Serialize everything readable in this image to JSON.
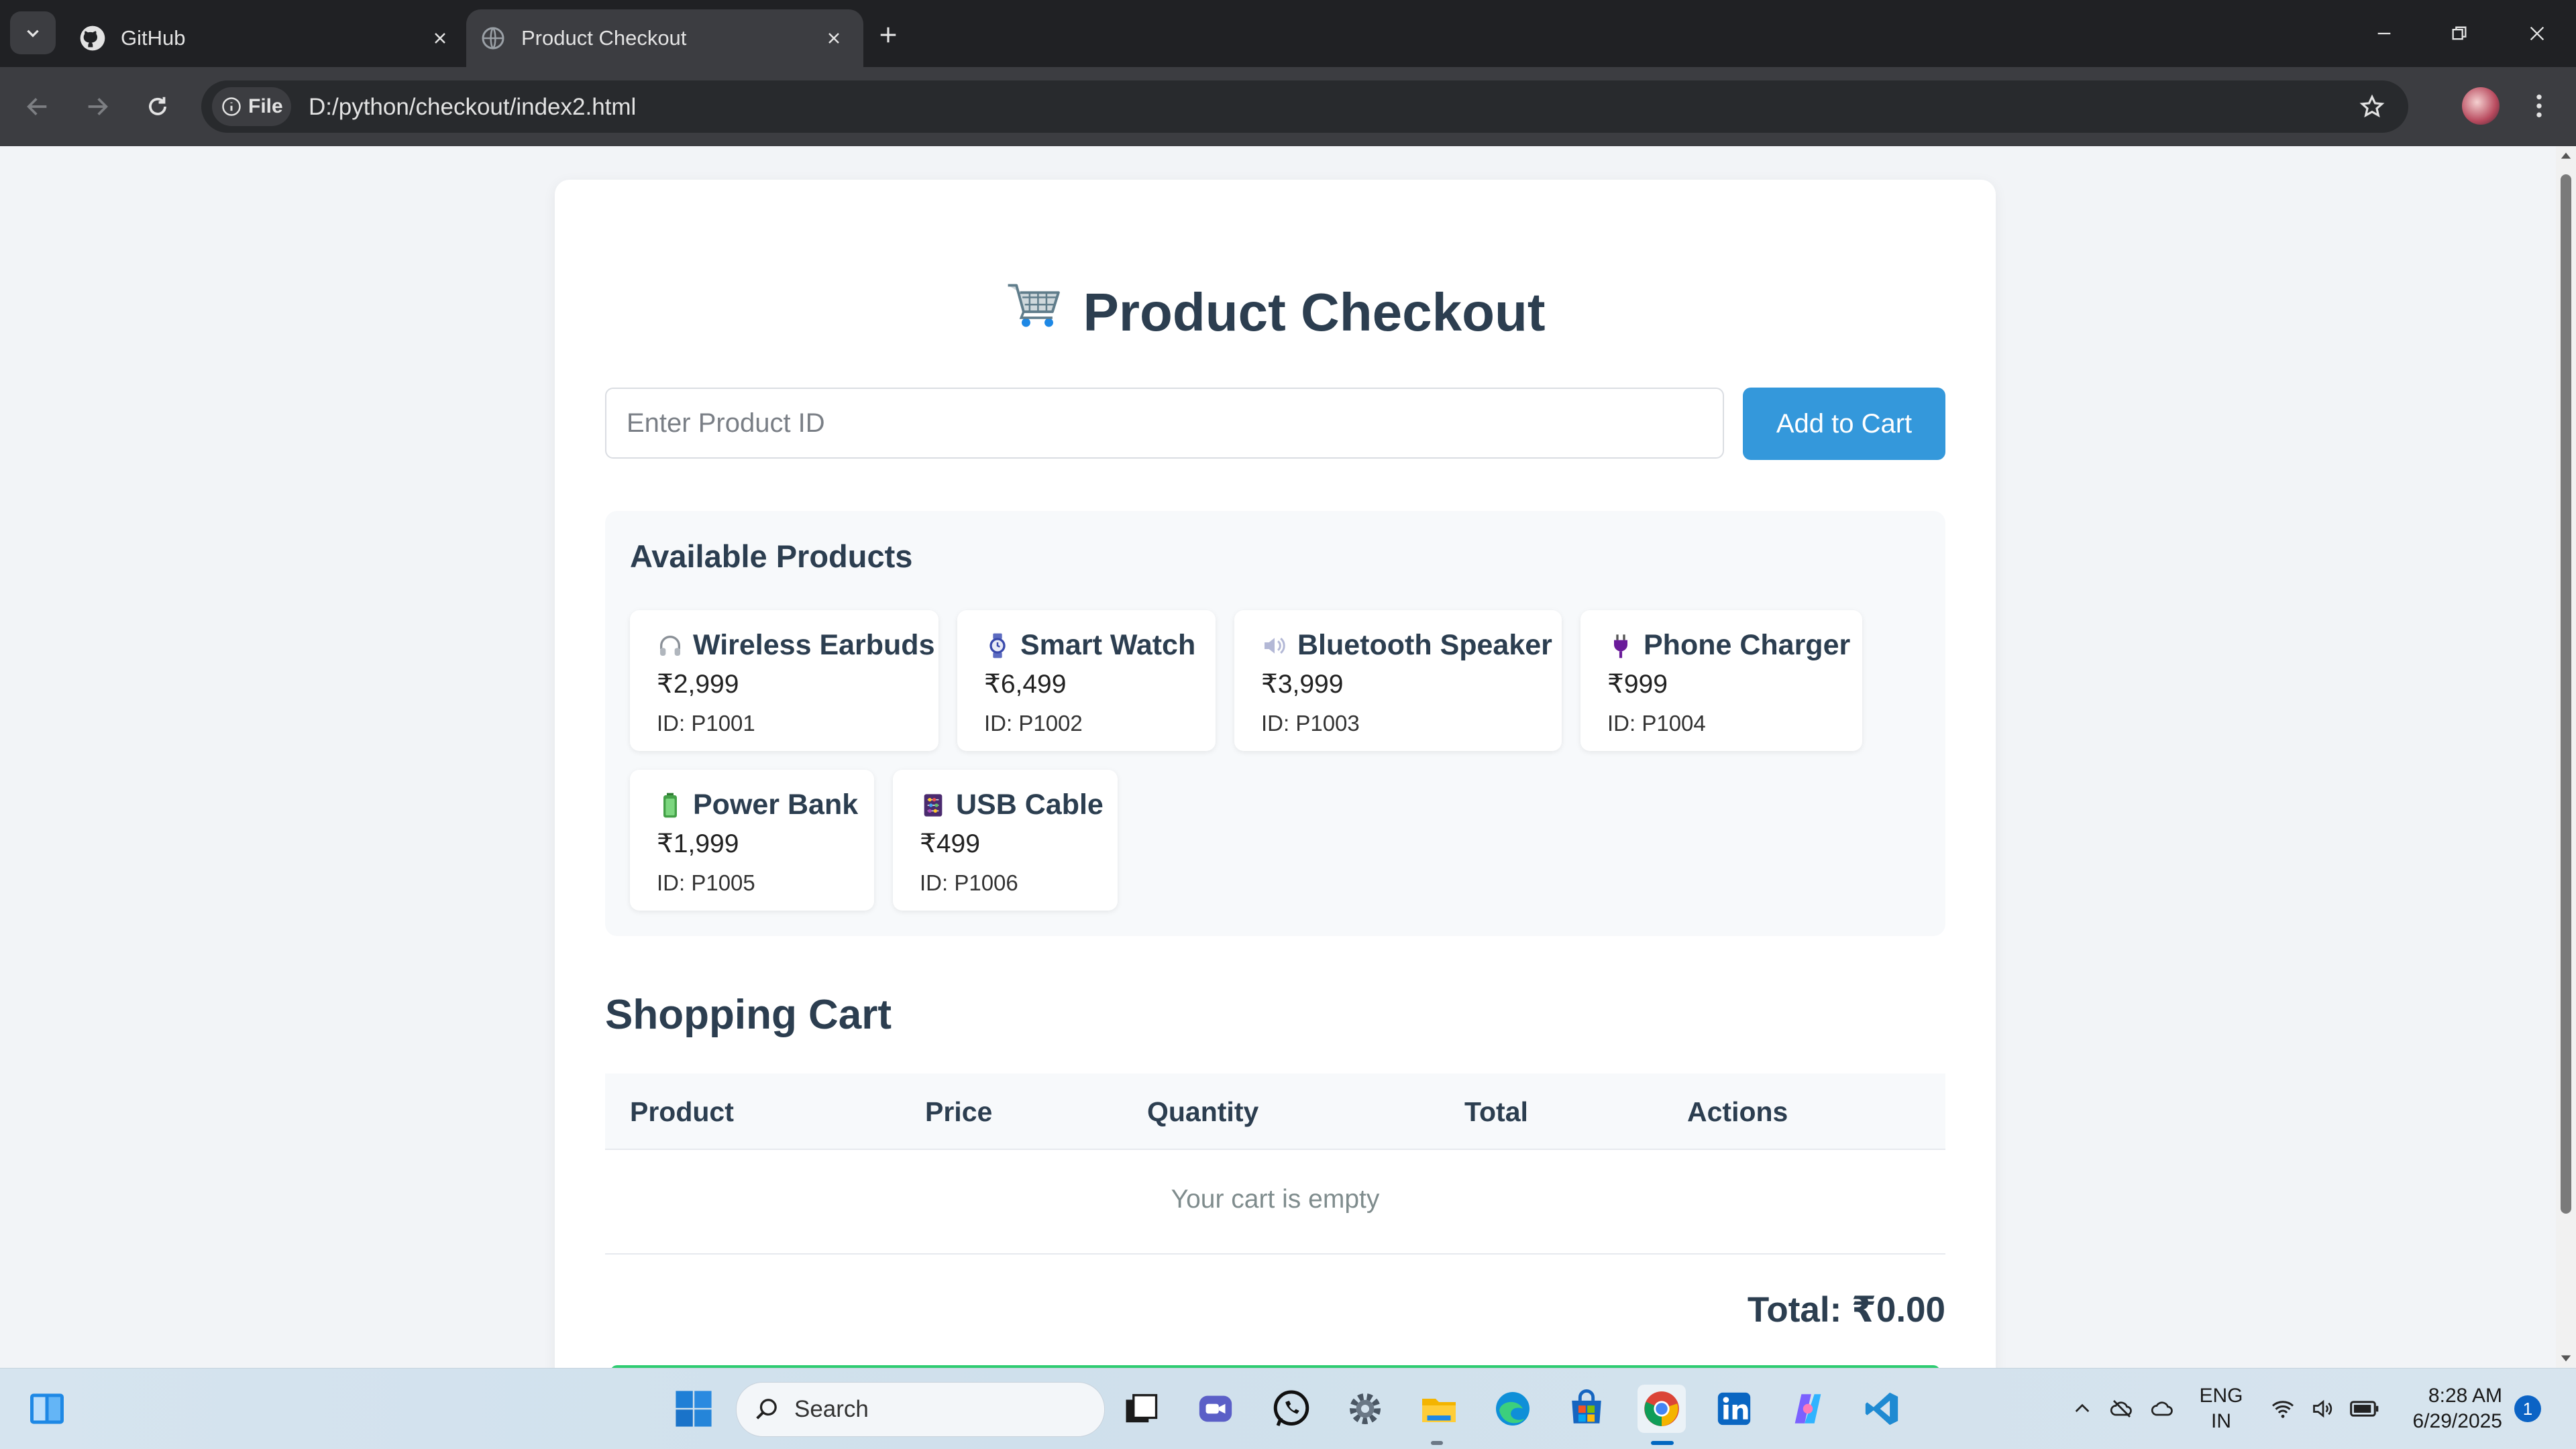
{
  "browser": {
    "tabs": [
      {
        "title": "GitHub",
        "icon": "github-icon"
      },
      {
        "title": "Product Checkout",
        "icon": "globe-icon",
        "active": true
      }
    ],
    "url_chip": "File",
    "url": "D:/python/checkout/index2.html"
  },
  "page": {
    "title": "Product Checkout",
    "title_icon": "shopping-cart-icon",
    "input_placeholder": "Enter Product ID",
    "add_button": "Add to Cart",
    "available_title": "Available Products",
    "products": [
      {
        "name": "Wireless Earbuds",
        "price": "₹2,999",
        "id": "ID: P1001",
        "icon": "headphones-icon"
      },
      {
        "name": "Smart Watch",
        "price": "₹6,499",
        "id": "ID: P1002",
        "icon": "watch-icon"
      },
      {
        "name": "Bluetooth Speaker",
        "price": "₹3,999",
        "id": "ID: P1003",
        "icon": "speaker-icon"
      },
      {
        "name": "Phone Charger",
        "price": "₹999",
        "id": "ID: P1004",
        "icon": "plug-icon"
      },
      {
        "name": "Power Bank",
        "price": "₹1,999",
        "id": "ID: P1005",
        "icon": "battery-icon"
      },
      {
        "name": "USB Cable",
        "price": "₹499",
        "id": "ID: P1006",
        "icon": "abacus-icon"
      }
    ],
    "cart_title": "Shopping Cart",
    "columns": [
      "Product",
      "Price",
      "Quantity",
      "Total",
      "Actions"
    ],
    "empty_text": "Your cart is empty",
    "total_text": "Total: ₹0.00"
  },
  "taskbar": {
    "search_label": "Search",
    "lang_line1": "ENG",
    "lang_line2": "IN",
    "time": "8:28 AM",
    "date": "6/29/2025",
    "notification_count": "1"
  },
  "colors": {
    "accent": "#3498db",
    "heading": "#2c3e50",
    "checkout_green": "#2ecc71"
  }
}
